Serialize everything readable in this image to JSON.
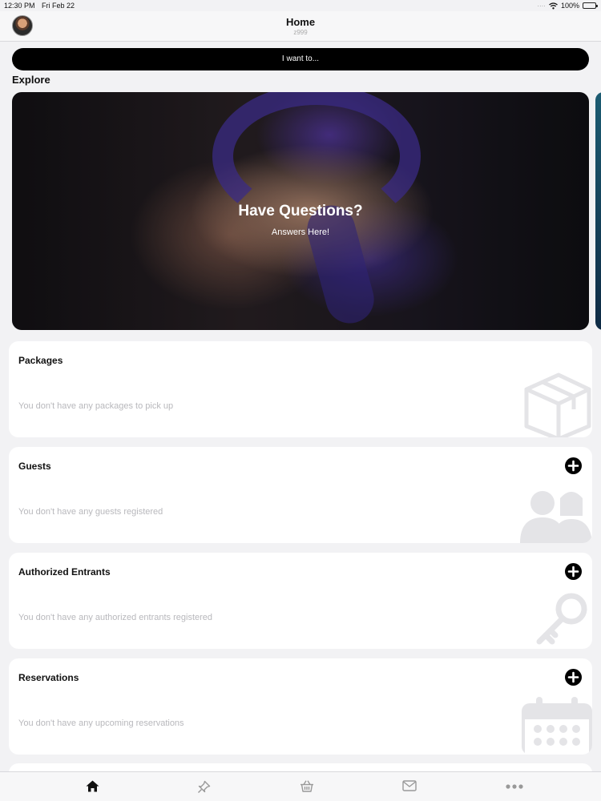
{
  "status_bar": {
    "time": "12:30 PM",
    "date": "Fri Feb 22",
    "battery": "100%"
  },
  "nav": {
    "title": "Home",
    "subtitle": "z999"
  },
  "actions": {
    "want_to_label": "I want to..."
  },
  "explore": {
    "heading": "Explore",
    "banner": {
      "title": "Have Questions?",
      "subtitle": "Answers Here!"
    }
  },
  "cards": {
    "packages": {
      "title": "Packages",
      "empty": "You don't have any packages to pick up",
      "icon": "package-box-icon"
    },
    "guests": {
      "title": "Guests",
      "empty": "You don't have any guests registered",
      "icon": "people-icon"
    },
    "entrants": {
      "title": "Authorized Entrants",
      "empty": "You don't have any authorized entrants registered",
      "icon": "key-icon"
    },
    "reservations": {
      "title": "Reservations",
      "empty": "You don't have any upcoming reservations",
      "icon": "calendar-icon"
    }
  },
  "tabs": [
    {
      "name": "home",
      "icon": "home-icon",
      "active": true
    },
    {
      "name": "pin",
      "icon": "pin-icon",
      "active": false
    },
    {
      "name": "basket",
      "icon": "basket-icon",
      "active": false
    },
    {
      "name": "mail",
      "icon": "mail-icon",
      "active": false
    },
    {
      "name": "more",
      "icon": "more-icon",
      "active": false
    }
  ],
  "colors": {
    "accent": "#000000",
    "background": "#f2f2f4",
    "muted_text": "#b8b8bc"
  }
}
